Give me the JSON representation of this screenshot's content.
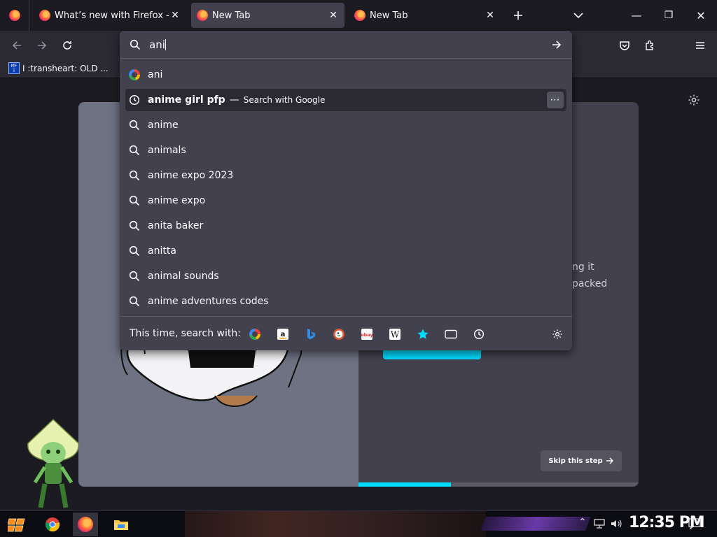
{
  "tabs": [
    {
      "title": "What’s new with Firefox - Mo",
      "active": false
    },
    {
      "title": "New Tab",
      "active": true
    },
    {
      "title": "New Tab",
      "active": false
    }
  ],
  "tab_close_glyph": "✕",
  "window_controls": {
    "minimize": "—",
    "restore": "❐",
    "close": "✕"
  },
  "bookmarks": [
    {
      "icon_text": "MF T",
      "label": "I :transheart: OLD ..."
    }
  ],
  "urlbar": {
    "typed_value": "ani",
    "suggestions": [
      {
        "type": "search-engine",
        "icon": "google-icon",
        "bold": "",
        "text": "ani"
      },
      {
        "type": "history",
        "icon": "clock-icon",
        "bold": "anime girl pfp",
        "text": "anime girl pfp",
        "sep": "—",
        "action": "Search with Google",
        "highlighted": true
      },
      {
        "type": "search",
        "icon": "search-icon",
        "text": "anime"
      },
      {
        "type": "search",
        "icon": "search-icon",
        "text": "animals"
      },
      {
        "type": "search",
        "icon": "search-icon",
        "text": "anime expo 2023"
      },
      {
        "type": "search",
        "icon": "search-icon",
        "text": "anime expo"
      },
      {
        "type": "search",
        "icon": "search-icon",
        "text": "anita baker"
      },
      {
        "type": "search",
        "icon": "search-icon",
        "text": "anitta"
      },
      {
        "type": "search",
        "icon": "search-icon",
        "text": "animal sounds"
      },
      {
        "type": "search",
        "icon": "search-icon",
        "text": "anime adventures codes"
      }
    ],
    "one_off_label": "This time, search with:",
    "one_off_engines": [
      "Google",
      "Amazon",
      "Bing",
      "DuckDuckGo",
      "eBay",
      "Wikipedia",
      "Bookmarks",
      "Tabs",
      "History"
    ],
    "more_glyph": "⋯"
  },
  "page": {
    "text_line1": "ng it",
    "text_line2": "packed",
    "skip_label": "Skip this step",
    "progress_fraction": 0.33
  },
  "taskbar": {
    "clock": "12:35 PM",
    "apps": [
      "start",
      "chrome",
      "firefox",
      "file-explorer"
    ]
  },
  "colors": {
    "accent": "#00ddff",
    "panel": "#42414d",
    "toolbar": "#2b2a33",
    "background": "#1c1b22"
  }
}
